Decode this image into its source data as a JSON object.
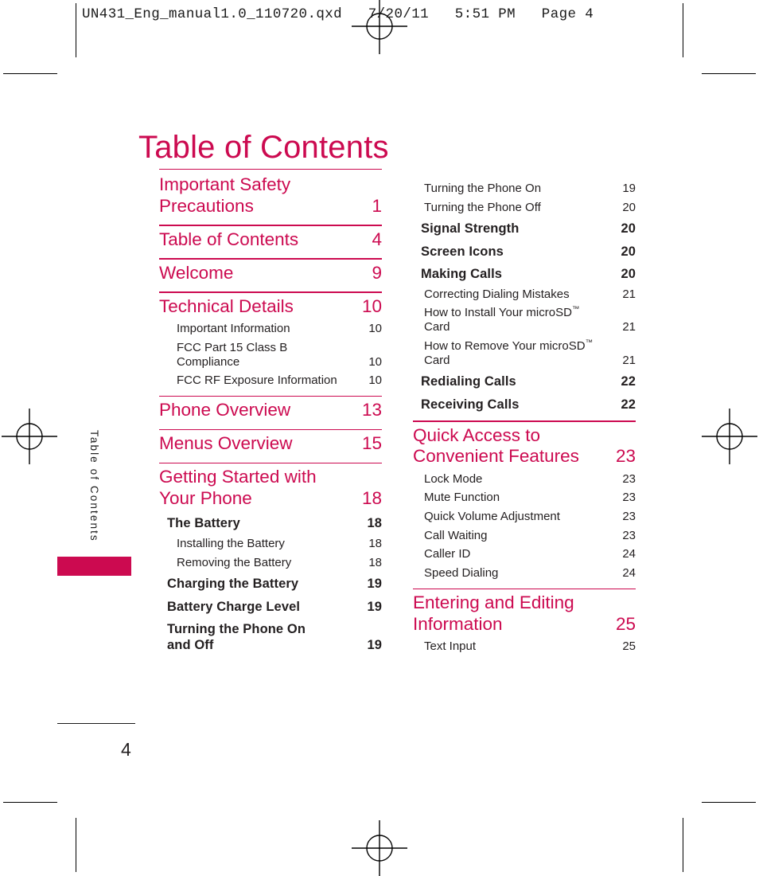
{
  "slug": "UN431_Eng_manual1.0_110720.qxd   7/20/11   5:51 PM   Page 4",
  "page_title": "Table of Contents",
  "side_tab_label": "Table of Contents",
  "folio": "4",
  "colors": {
    "accent": "#cc0a50",
    "text": "#231f20"
  },
  "left_column": [
    {
      "level": 1,
      "rule_above": true,
      "label": "Important Safety Precautions",
      "page": "1"
    },
    {
      "level": 1,
      "rule_above": true,
      "label": "Table of Contents",
      "page": "4"
    },
    {
      "level": 1,
      "rule_above": true,
      "label": "Welcome",
      "page": "9"
    },
    {
      "level": 1,
      "rule_above": true,
      "label": "Technical Details",
      "page": "10"
    },
    {
      "level": 3,
      "rule_above": false,
      "label": "Important Information",
      "page": "10"
    },
    {
      "level": 3,
      "rule_above": false,
      "label": "FCC Part 15 Class B Compliance",
      "page": "10"
    },
    {
      "level": 3,
      "rule_above": false,
      "label": "FCC RF Exposure Information",
      "page": "10"
    },
    {
      "level": 1,
      "rule_above": true,
      "label": "Phone Overview",
      "page": "13"
    },
    {
      "level": 1,
      "rule_above": true,
      "label": "Menus Overview",
      "page": "15"
    },
    {
      "level": 1,
      "rule_above": true,
      "label": "Getting Started with Your Phone",
      "page": "18"
    },
    {
      "level": 2,
      "rule_above": false,
      "label": "The Battery",
      "page": "18"
    },
    {
      "level": 3,
      "rule_above": false,
      "label": "Installing the Battery",
      "page": "18"
    },
    {
      "level": 3,
      "rule_above": false,
      "label": "Removing the Battery",
      "page": "18"
    },
    {
      "level": 2,
      "rule_above": false,
      "label": "Charging the Battery",
      "page": "19"
    },
    {
      "level": 2,
      "rule_above": false,
      "label": "Battery Charge Level",
      "page": "19"
    },
    {
      "level": 2,
      "rule_above": false,
      "label": "Turning the Phone On and Off",
      "page": "19"
    }
  ],
  "right_column": [
    {
      "level": 3,
      "rule_above": false,
      "label": "Turning the Phone On",
      "page": "19"
    },
    {
      "level": 3,
      "rule_above": false,
      "label": "Turning the Phone Off",
      "page": "20"
    },
    {
      "level": 2,
      "rule_above": false,
      "label": "Signal Strength",
      "page": "20"
    },
    {
      "level": 2,
      "rule_above": false,
      "label": "Screen Icons",
      "page": "20"
    },
    {
      "level": 2,
      "rule_above": false,
      "label": "Making Calls",
      "page": "20"
    },
    {
      "level": 3,
      "rule_above": false,
      "label": "Correcting Dialing Mistakes",
      "page": "21"
    },
    {
      "level": 3,
      "rule_above": false,
      "label": "How to Install Your microSD™ Card",
      "page": "21"
    },
    {
      "level": 3,
      "rule_above": false,
      "label": "How to Remove Your microSD™ Card",
      "page": "21"
    },
    {
      "level": 2,
      "rule_above": false,
      "label": "Redialing Calls",
      "page": "22"
    },
    {
      "level": 2,
      "rule_above": false,
      "label": "Receiving Calls",
      "page": "22"
    },
    {
      "level": 1,
      "rule_above": true,
      "label": "Quick Access to Convenient Features",
      "page": "23"
    },
    {
      "level": 3,
      "rule_above": false,
      "label": "Lock Mode",
      "page": "23"
    },
    {
      "level": 3,
      "rule_above": false,
      "label": "Mute Function",
      "page": "23"
    },
    {
      "level": 3,
      "rule_above": false,
      "label": "Quick Volume Adjustment",
      "page": "23"
    },
    {
      "level": 3,
      "rule_above": false,
      "label": "Call Waiting",
      "page": "23"
    },
    {
      "level": 3,
      "rule_above": false,
      "label": "Caller ID",
      "page": "24"
    },
    {
      "level": 3,
      "rule_above": false,
      "label": "Speed Dialing",
      "page": "24"
    },
    {
      "level": 1,
      "rule_above": true,
      "label": "Entering and Editing Information",
      "page": "25"
    },
    {
      "level": 3,
      "rule_above": false,
      "label": "Text Input",
      "page": "25"
    }
  ]
}
